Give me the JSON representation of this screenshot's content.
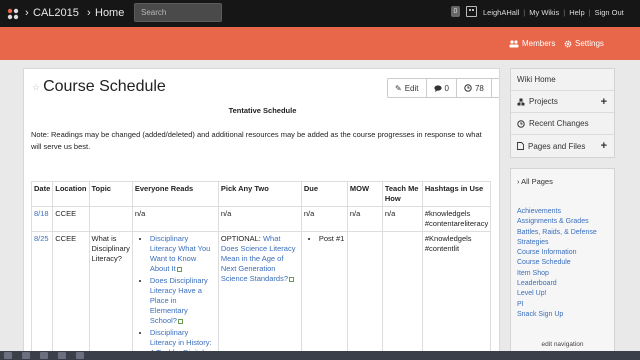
{
  "header": {
    "breadcrumb": [
      "CAL2015",
      "Home"
    ],
    "search_placeholder": "Search",
    "notification_count": "0",
    "links": [
      "LeighAHall",
      "My Wikis",
      "Help",
      "Sign Out"
    ]
  },
  "subheader": {
    "members_label": "Members",
    "settings_label": "Settings"
  },
  "page": {
    "title": "Course Schedule",
    "edit_label": "Edit",
    "comments_count": "0",
    "views_count": "78",
    "more_label": "...",
    "heading": "Tentative Schedule",
    "note": "Note: Readings may be changed (added/deleted) and additional resources may be added as the course progresses in response to what will serve us best."
  },
  "table": {
    "headers": [
      "Date",
      "Location",
      "Topic",
      "Everyone Reads",
      "Pick Any Two",
      "Due",
      "MOW",
      "Teach Me How",
      "Hashtags in Use"
    ],
    "row1": {
      "date": "8/18",
      "location": "CCEE",
      "topic": "",
      "reads": "n/a",
      "pick": "n/a",
      "due": "n/a",
      "mow": "n/a",
      "teach": "n/a",
      "hashtags": [
        "#knowledgels",
        "#contentareliteracy"
      ]
    },
    "row2": {
      "date": "8/25",
      "location": "CCEE",
      "topic": "What is Disciplinary Literacy?",
      "reads": [
        "Disciplinary Literacy What You Want to Know About It",
        "Does Disciplinary Literacy Have a Place in Elementary School?",
        "Disciplinary Literacy in History: A Tool for Digital Citizenship"
      ],
      "pick_prefix": "OPTIONAL:",
      "pick_link": "What Does Science Literacy Mean in the Age of Next Generation Science Standards?",
      "due": "Post #1",
      "mow": "",
      "teach": "",
      "hashtags": [
        "#Knowledgels",
        "#contentlit"
      ]
    }
  },
  "sidebar": {
    "wiki_home": "Wiki Home",
    "projects": "Projects",
    "recent_changes": "Recent Changes",
    "pages_and_files": "Pages and Files",
    "all_pages": "All Pages",
    "links": [
      "Achievements",
      "Assignments & Grades",
      "Battles, Raids, & Defense Strategies",
      "Course Information",
      "Course Schedule",
      "Item Shop",
      "Leaderboard",
      "Level Up!",
      "PI",
      "Snack Sign Up"
    ],
    "edit_navigation": "edit navigation"
  },
  "colors": {
    "accent": "#e8664a",
    "topbar": "#161616",
    "link": "#3a6fbd"
  }
}
